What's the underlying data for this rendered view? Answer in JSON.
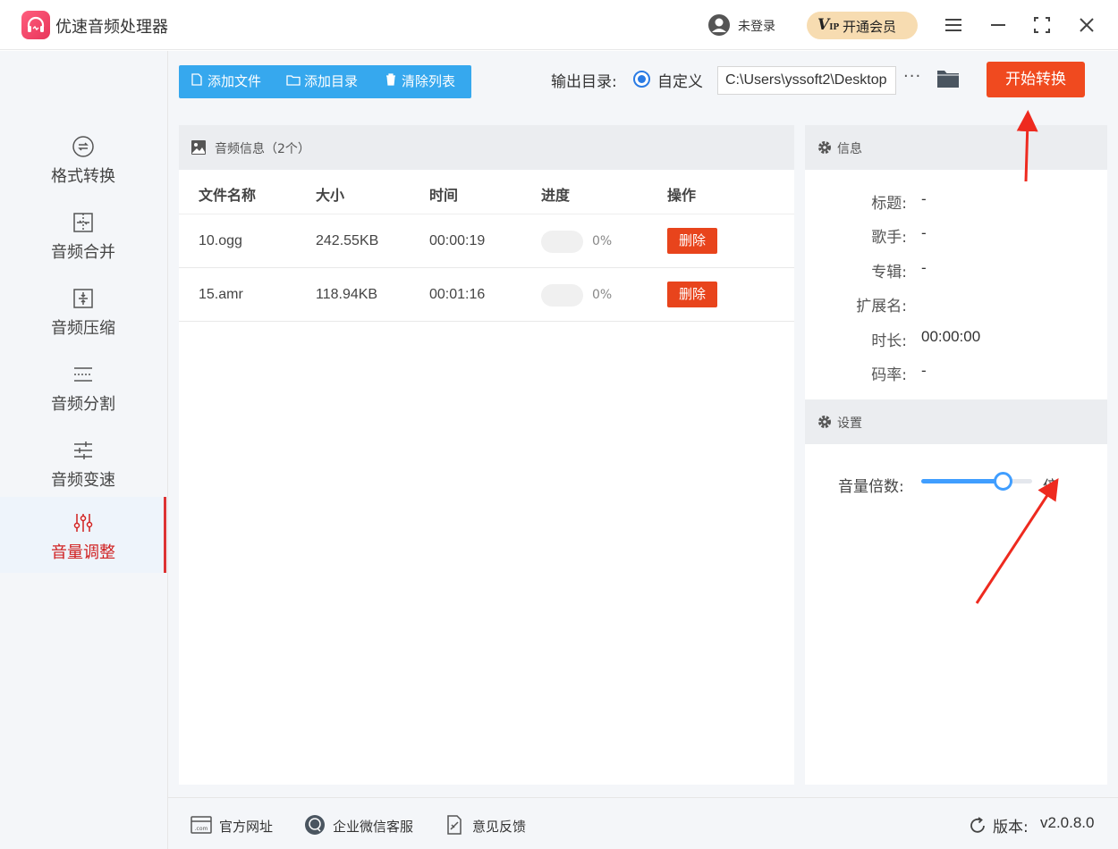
{
  "app": {
    "title": "优速音频处理器",
    "login_text": "未登录",
    "vip_badge": "V",
    "vip_badge_small": "IP",
    "vip_label": "开通会员",
    "icons": {
      "logo": "headphones-icon",
      "user": "user-icon",
      "menu": "menu-icon",
      "minimize": "minimize-icon",
      "maximize": "maximize-icon",
      "close": "close-icon"
    }
  },
  "sidebar": {
    "items": [
      {
        "label": "格式转换",
        "icon": "format-convert-icon",
        "active": false
      },
      {
        "label": "音频合并",
        "icon": "audio-merge-icon",
        "active": false
      },
      {
        "label": "音频压缩",
        "icon": "audio-compress-icon",
        "active": false
      },
      {
        "label": "音频分割",
        "icon": "audio-split-icon",
        "active": false
      },
      {
        "label": "音频变速",
        "icon": "audio-speed-icon",
        "active": false
      },
      {
        "label": "音量调整",
        "icon": "volume-adjust-icon",
        "active": true
      }
    ]
  },
  "toolbar": {
    "add_file": "添加文件",
    "add_folder": "添加目录",
    "clear_list": "清除列表",
    "output_label": "输出目录:",
    "radio_label": "自定义",
    "output_path": "C:\\Users\\yssoft2\\Desktop",
    "more": "···",
    "start": "开始转换",
    "accent_color": "#36a8ee",
    "start_color": "#f04a1f"
  },
  "file_list": {
    "header": "音频信息（2个）",
    "columns": [
      "文件名称",
      "大小",
      "时间",
      "进度",
      "操作"
    ],
    "rows": [
      {
        "name": "10.ogg",
        "size": "242.55KB",
        "time": "00:00:19",
        "progress": 0,
        "progress_text": "0%",
        "action": "删除"
      },
      {
        "name": "15.amr",
        "size": "118.94KB",
        "time": "00:01:16",
        "progress": 0,
        "progress_text": "0%",
        "action": "删除"
      }
    ]
  },
  "info": {
    "header": "信息",
    "fields": [
      {
        "key": "标题:",
        "value": "-"
      },
      {
        "key": "歌手:",
        "value": "-"
      },
      {
        "key": "专辑:",
        "value": "-"
      },
      {
        "key": "扩展名:",
        "value": ""
      },
      {
        "key": "时长:",
        "value": "00:00:00"
      },
      {
        "key": "码率:",
        "value": "-"
      }
    ]
  },
  "settings": {
    "header": "设置",
    "volume_label": "音量倍数:",
    "volume_level": 0.73,
    "volume_unit": "倍"
  },
  "footer": {
    "website": "官方网址",
    "wechat": "企业微信客服",
    "feedback": "意见反馈",
    "version_label": "版本:",
    "version": "v2.0.8.0"
  }
}
